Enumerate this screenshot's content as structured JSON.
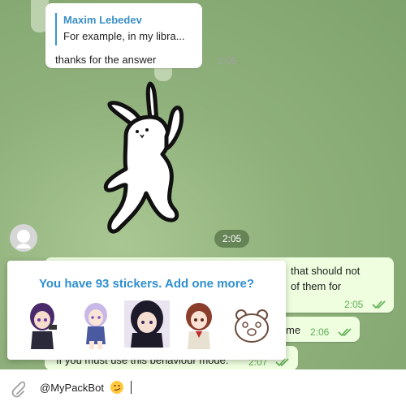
{
  "reply_message": {
    "quote_author": "Maxim Lebedev",
    "quote_text": "For example, in my libra...",
    "text": "thanks for the answer",
    "time": "2:05"
  },
  "sticker_message": {
    "time": "2:05"
  },
  "outgoing": [
    {
      "line1": "that should not",
      "line2": "of them for",
      "time": "2:05"
    },
    {
      "text": "me",
      "time": "2:06"
    },
    {
      "text": "If you must use this behaviour mode:",
      "time": "2:07"
    }
  ],
  "sticker_panel": {
    "title": "You have 93 stickers. Add one more?"
  },
  "input": {
    "value": "@MyPackBot"
  },
  "colors": {
    "accent": "#2f8fcf",
    "outgoing_bubble": "#eefedf",
    "check_green": "#5fae53"
  },
  "icons": [
    "paperclip-icon",
    "double-check-icon",
    "smirk-emoji-icon"
  ]
}
